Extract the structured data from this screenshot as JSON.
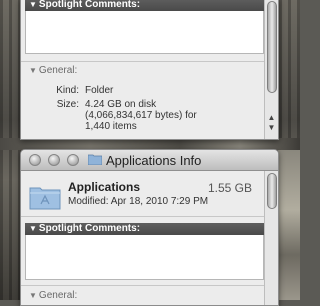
{
  "top_window": {
    "spotlight_header": "Spotlight Comments:",
    "general_header": "General:",
    "kind_label": "Kind:",
    "kind_value": "Folder",
    "size_label": "Size:",
    "size_value_line1": "4.24 GB on disk",
    "size_value_line2": "(4,066,834,617 bytes) for",
    "size_value_line3": "1,440 items"
  },
  "bottom_window": {
    "title": "Applications Info",
    "name": "Applications",
    "size": "1.55 GB",
    "modified": "Modified: Apr 18, 2010 7:29 PM",
    "spotlight_header": "Spotlight Comments:",
    "general_header": "General:"
  },
  "icons": {
    "disclosure": "triangle-down-icon",
    "folder": "folder-icon",
    "window_buttons": [
      "close-button",
      "minimize-button",
      "zoom-button"
    ]
  },
  "colors": {
    "section_bar": "#4f4f4f",
    "window_bg": "#ececec"
  }
}
